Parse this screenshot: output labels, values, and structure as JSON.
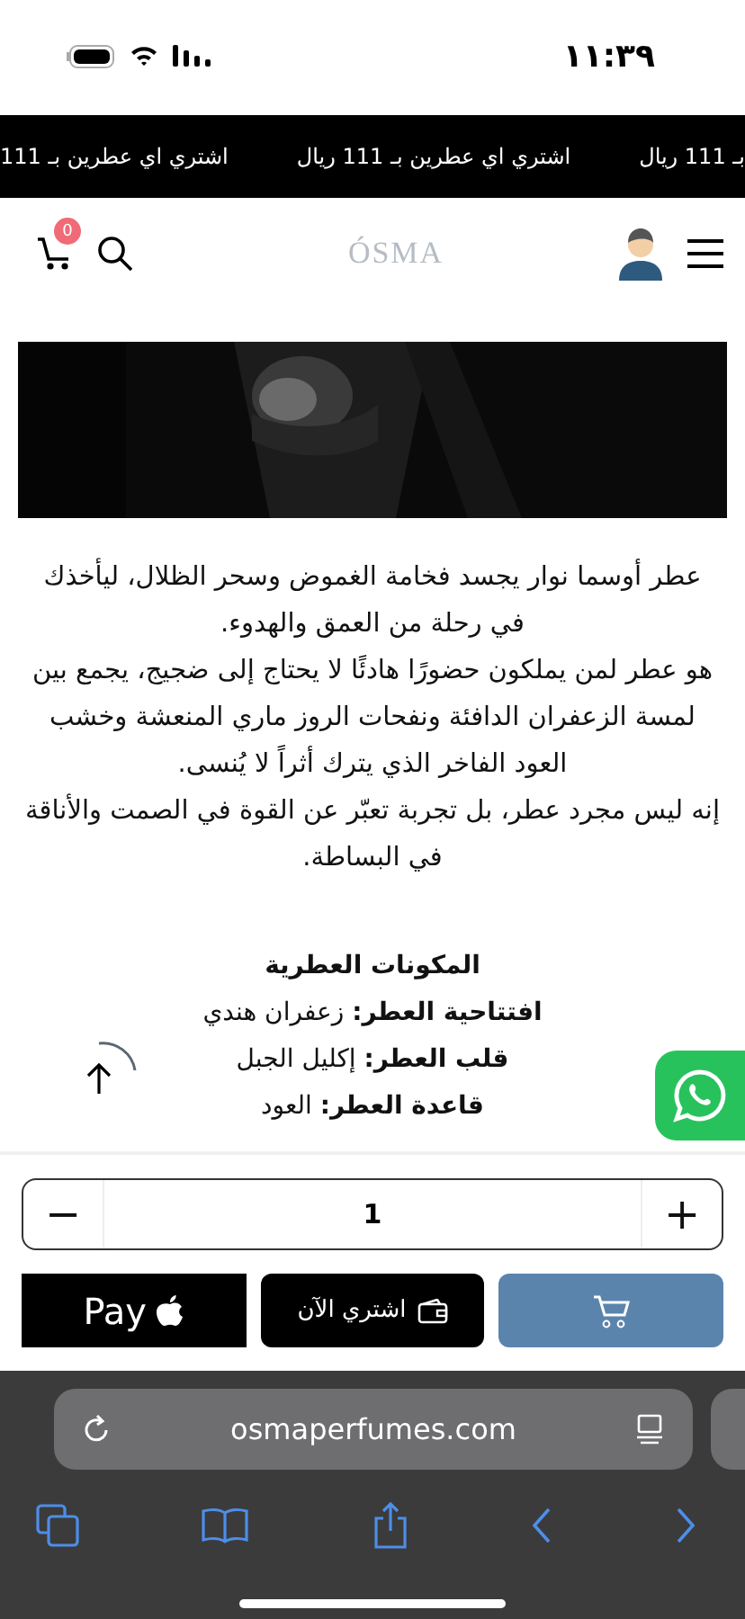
{
  "status_bar": {
    "time": "١١:٣٩"
  },
  "announcement_bar": {
    "items": [
      "بـ 111 ريال",
      "اشتري اي عطرين بـ 111 ريال",
      "اشتري اي عطرين بـ 111"
    ]
  },
  "header": {
    "logo": "ÓSMA",
    "cart_count": "0"
  },
  "description": {
    "paragraphs": [
      "عطر أوسما نوار يجسد فخامة الغموض وسحر الظلال، ليأخذك في رحلة من العمق والهدوء.",
      "هو عطر لمن يملكون حضورًا هادئًا لا يحتاج إلى ضجيج، يجمع بين لمسة الزعفران الدافئة ونفحات الروز ماري المنعشة وخشب العود الفاخر الذي يترك أثراً لا يُنسى.",
      "إنه ليس مجرد عطر، بل تجربة تعبّر عن القوة في الصمت والأناقة في البساطة."
    ]
  },
  "ingredients": {
    "title": "المكونات العطرية",
    "notes": [
      "**افتتاحية العطر:** زعفران هندي",
      "**قلب العطر:** إكليل الجبل",
      "**قاعدة العطر:** العود"
    ]
  },
  "purchase": {
    "decrease": "−",
    "quantity": "1",
    "increase": "+",
    "buttons": [
      {
        "kind": "add_to_cart"
      },
      {
        "kind": "buy_now",
        "label": "اشتري الآن"
      },
      {
        "kind": "apple_pay",
        "label": "Pay"
      }
    ]
  },
  "browser": {
    "url": "osmaperfumes.com"
  }
}
